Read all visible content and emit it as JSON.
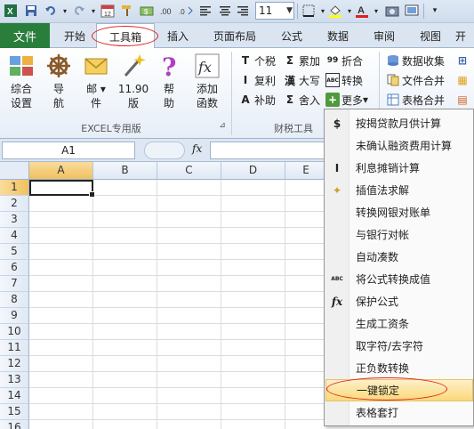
{
  "qat": {
    "font_size": "11",
    "icons": [
      "excel-app-icon",
      "save-icon",
      "undo-icon",
      "redo-icon",
      "calendar-icon",
      "format-painter-icon",
      "currency-icon",
      "align-left-icon",
      "align-center-icon",
      "align-right-icon",
      "borders-icon",
      "fill-color-icon",
      "font-color-icon",
      "camera-icon",
      "screen-capture-icon",
      "customize-qat-icon"
    ]
  },
  "tabs": {
    "file": "文件",
    "items": [
      "开始",
      "工具箱",
      "插入",
      "页面布局",
      "公式",
      "数据",
      "审阅",
      "视图",
      "开"
    ],
    "active": "工具箱"
  },
  "ribbon": {
    "excel_group": {
      "label": "EXCEL专用版",
      "buttons": [
        {
          "line1": "综合",
          "line2": "设置"
        },
        {
          "line1": "导",
          "line2": "航"
        },
        {
          "line1": "邮",
          "line2": "件"
        },
        {
          "line1": "11.90",
          "line2": "版"
        },
        {
          "line1": "帮",
          "line2": "助"
        },
        {
          "line1": "添加",
          "line2": "函数"
        }
      ]
    },
    "tax_group": {
      "label": "财税工具",
      "buttons": [
        {
          "icon": "T",
          "label": "个税"
        },
        {
          "icon": "Σ",
          "label": "累加"
        },
        {
          "icon": "99",
          "label": "折合"
        },
        {
          "icon": "I",
          "label": "复利"
        },
        {
          "icon": "漢",
          "label": "大写"
        },
        {
          "icon": "ABC",
          "label": "转换"
        },
        {
          "icon": "A",
          "label": "补助"
        },
        {
          "icon": "Σ",
          "label": "舍入"
        },
        {
          "icon": "+",
          "label": "更多"
        }
      ]
    },
    "data_group": {
      "buttons": [
        {
          "label": "数据收集"
        },
        {
          "label": "文件合并"
        },
        {
          "label": "表格合并"
        }
      ]
    }
  },
  "formula_bar": {
    "name_box": "A1",
    "fx": "fx"
  },
  "grid": {
    "columns": [
      "A",
      "B",
      "C",
      "D",
      "E"
    ],
    "rows": [
      "1",
      "2",
      "3",
      "4",
      "5",
      "6",
      "7",
      "8",
      "9",
      "10",
      "11",
      "12",
      "13",
      "14",
      "15",
      "16"
    ]
  },
  "menu": {
    "items": [
      {
        "icon": "$",
        "label": "按揭贷款月供计算"
      },
      {
        "icon": "",
        "label": "未确认融资费用计算"
      },
      {
        "icon": "I",
        "label": "利息摊销计算"
      },
      {
        "icon": "✦",
        "label": "插值法求解"
      },
      {
        "icon": "",
        "label": "转换网银对账单"
      },
      {
        "icon": "",
        "label": "与银行对帐"
      },
      {
        "icon": "",
        "label": "自动凑数"
      },
      {
        "icon": "ABC",
        "label": "将公式转换成值"
      },
      {
        "icon": "fx",
        "label": "保护公式"
      },
      {
        "icon": "",
        "label": "生成工资条"
      },
      {
        "icon": "",
        "label": "取字符/去字符"
      },
      {
        "icon": "",
        "label": "正负数转换"
      },
      {
        "icon": "",
        "label": "一键锁定"
      },
      {
        "icon": "",
        "label": "表格套打"
      }
    ],
    "highlighted_index": 12
  }
}
